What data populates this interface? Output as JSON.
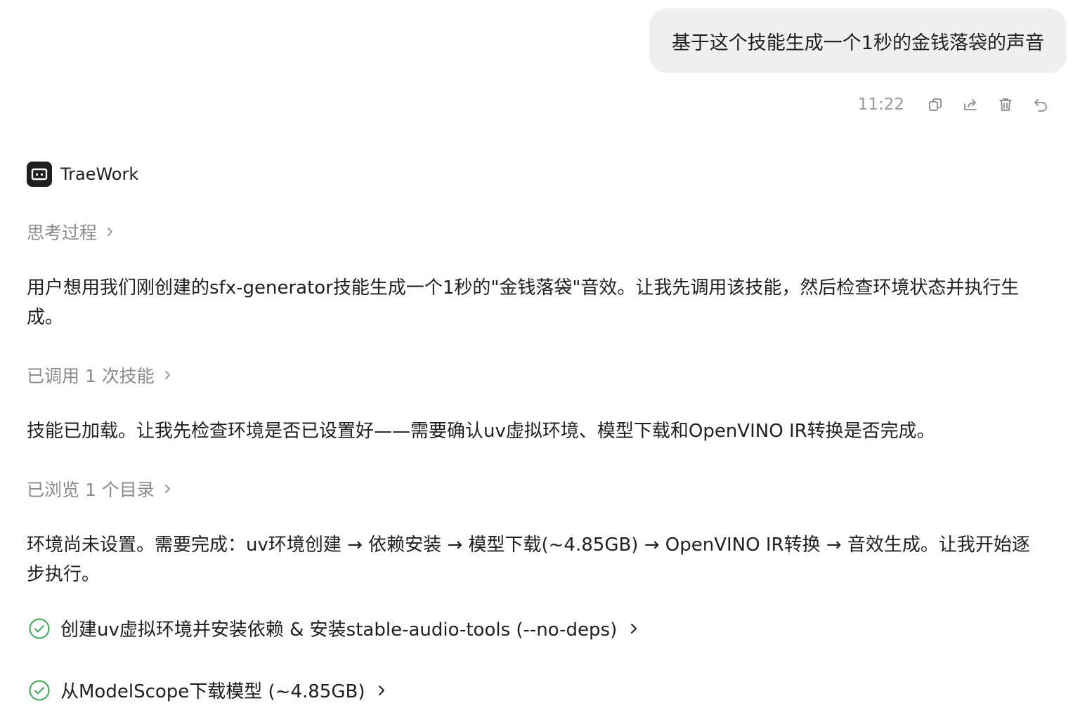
{
  "user_message": {
    "text": "基于这个技能生成一个1秒的金钱落袋的声音",
    "time": "11:22"
  },
  "message_actions": [
    "copy-icon",
    "share-icon",
    "delete-icon",
    "undo-icon"
  ],
  "assistant": {
    "name": "TraeWork",
    "thinking_label": "思考过程",
    "para1": "用户想用我们刚创建的sfx-generator技能生成一个1秒的\"金钱落袋\"音效。让我先调用该技能，然后检查环境状态并执行生成。",
    "skills_called_label": "已调用 1 次技能",
    "para2": "技能已加载。让我先检查环境是否已设置好——需要确认uv虚拟环境、模型下载和OpenVINO IR转换是否完成。",
    "browsed_label": "已浏览 1 个目录",
    "para3": "环境尚未设置。需要完成：uv环境创建 → 依赖安装 → 模型下载(~4.85GB) → OpenVINO IR转换 → 音效生成。让我开始逐步执行。",
    "tasks": [
      {
        "label": "创建uv虚拟环境并安装依赖 & 安装stable-audio-tools (--no-deps)",
        "status": "done"
      },
      {
        "label": "从ModelScope下载模型 (~4.85GB)",
        "status": "done"
      }
    ]
  },
  "colors": {
    "bubble_bg": "#efefef",
    "muted_text": "#8a8a8a",
    "check_green": "#3aa757"
  }
}
